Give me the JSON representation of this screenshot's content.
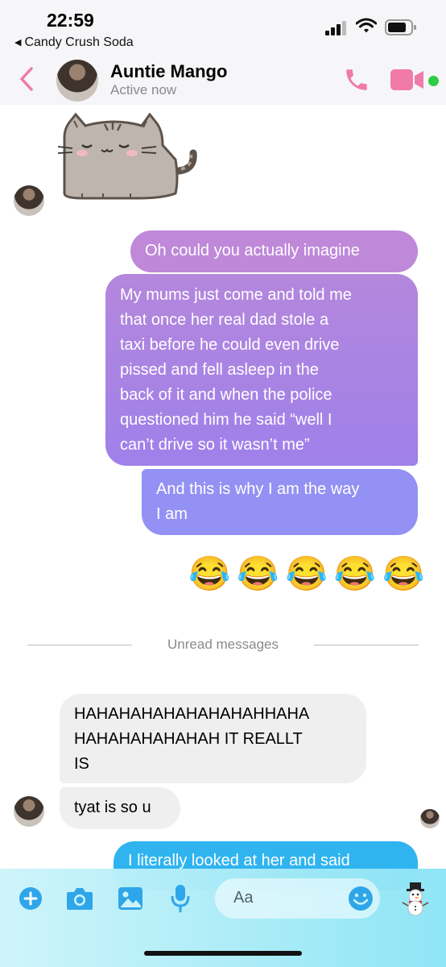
{
  "status_bar": {
    "time": "22:59",
    "back_app": "Candy Crush Soda"
  },
  "header": {
    "contact_name": "Auntie Mango",
    "status": "Active now"
  },
  "messages": [
    {
      "id": "out-1",
      "direction": "outgoing",
      "text": "Oh could you actually imagine"
    },
    {
      "id": "out-2",
      "direction": "outgoing",
      "lines": [
        "My mums just come and told me",
        "that once her real dad stole a",
        "taxi before he could even drive",
        "pissed and fell asleep in the",
        "back of it and when the police",
        "questioned him he said “well I",
        "can’t drive so it wasn’t me”"
      ]
    },
    {
      "id": "out-3",
      "direction": "outgoing",
      "lines": [
        "And this is why I am the way",
        "I am"
      ]
    },
    {
      "id": "out-4",
      "direction": "outgoing",
      "text": "😂😂😂😂😂"
    },
    {
      "id": "in-1",
      "direction": "incoming",
      "lines": [
        "HAHAHAHAHAHAHAHAHHAHA",
        "HAHAHAHAHAHAH IT REALLT",
        "IS"
      ]
    },
    {
      "id": "in-2",
      "direction": "incoming",
      "text": "tyat is so u"
    },
    {
      "id": "out-5",
      "direction": "outgoing",
      "text": "I literally looked at her and said"
    }
  ],
  "divider": {
    "label": "Unread messages"
  },
  "composer": {
    "placeholder": "Aa"
  },
  "colors": {
    "accent_pink": "#f07aa8",
    "bubble_top": "#bf88d9",
    "bubble_mid": "#a884e6",
    "bubble_bottom": "#9391f3",
    "incoming_bubble": "#efeff0",
    "composer_icon": "#2fa6e9",
    "active_green": "#31cc46"
  },
  "icons": [
    "back-chevron-icon",
    "phone-icon",
    "video-camera-icon",
    "plus-icon",
    "camera-icon",
    "image-icon",
    "microphone-icon",
    "emoji-icon",
    "snowman-icon"
  ]
}
